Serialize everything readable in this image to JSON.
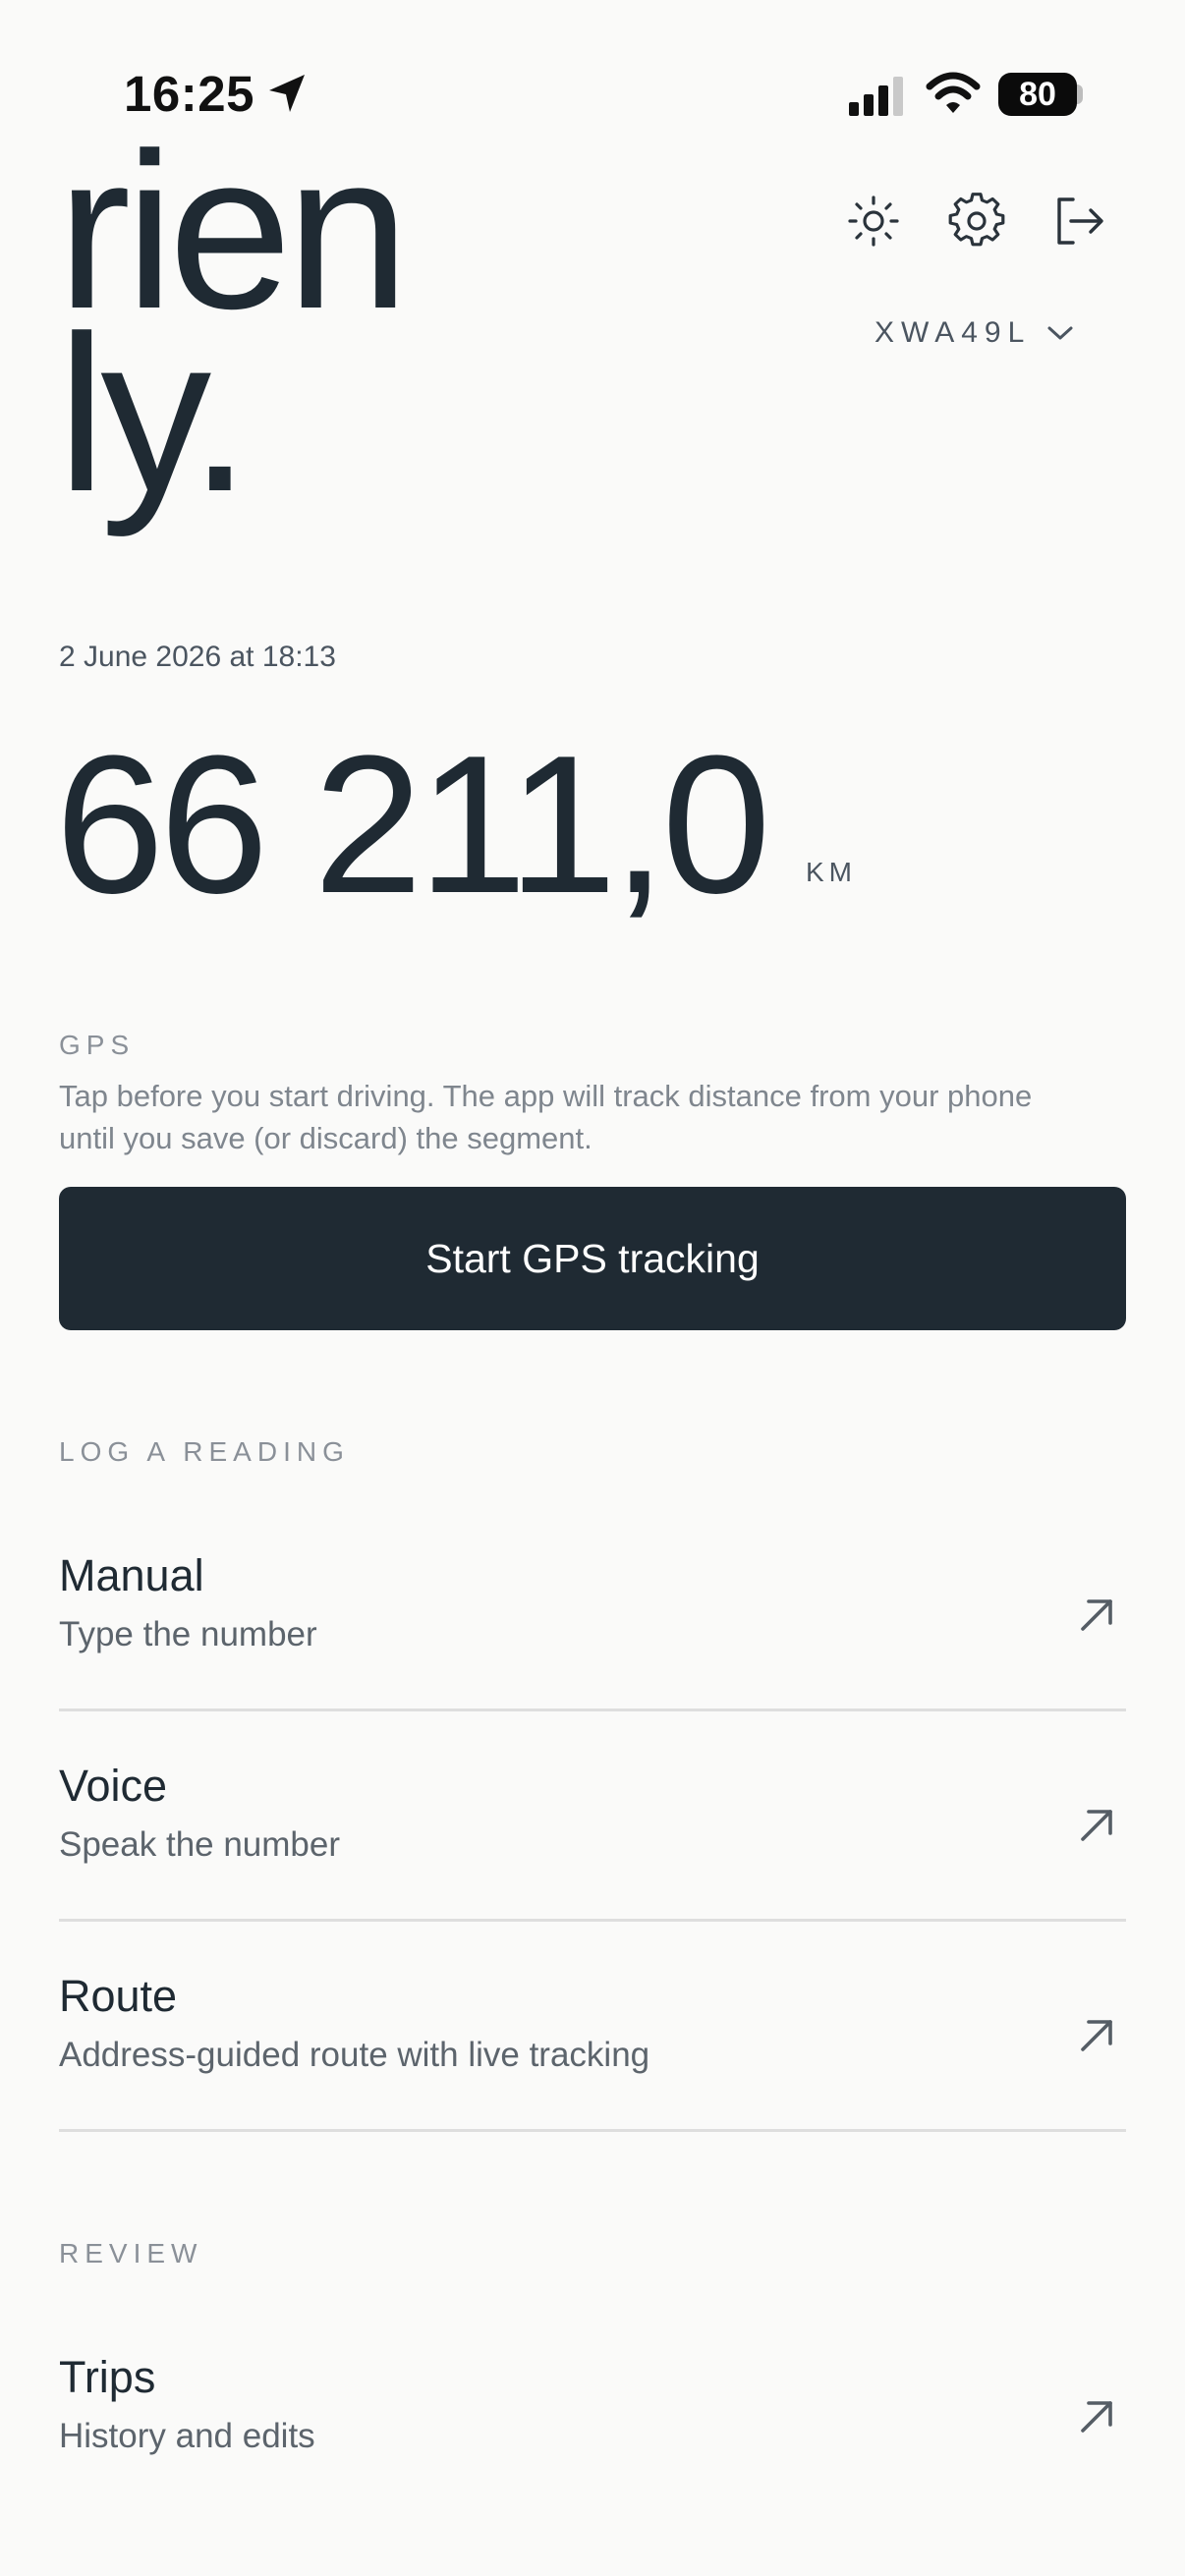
{
  "status_bar": {
    "time": "16:25",
    "battery": "80"
  },
  "brand": {
    "line1": "rien",
    "line2": "ly."
  },
  "header": {
    "vehicle_plate": "XWA49L"
  },
  "reading": {
    "timestamp": "2 June 2026 at 18:13",
    "value": "66 211,0",
    "unit": "KM"
  },
  "gps": {
    "label": "GPS",
    "description": "Tap before you start driving. The app will track distance from your phone until you save (or discard) the segment.",
    "button_label": "Start GPS tracking"
  },
  "log": {
    "label": "LOG A READING",
    "items": [
      {
        "title": "Manual",
        "subtitle": "Type the number"
      },
      {
        "title": "Voice",
        "subtitle": "Speak the number"
      },
      {
        "title": "Route",
        "subtitle": "Address-guided route with live tracking"
      }
    ]
  },
  "review": {
    "label": "REVIEW",
    "items": [
      {
        "title": "Trips",
        "subtitle": "History and edits"
      }
    ]
  },
  "icons": {
    "location": "location-arrow-icon",
    "signal": "cellular-signal-icon",
    "wifi": "wifi-icon",
    "theme": "sun-icon",
    "settings": "gear-icon",
    "logout": "logout-icon",
    "dropdown": "chevron-down-icon",
    "row_arrow": "arrow-up-right-icon"
  },
  "colors": {
    "background": "#fafaf9",
    "primary": "#1f2a33",
    "muted": "#8a9098"
  }
}
